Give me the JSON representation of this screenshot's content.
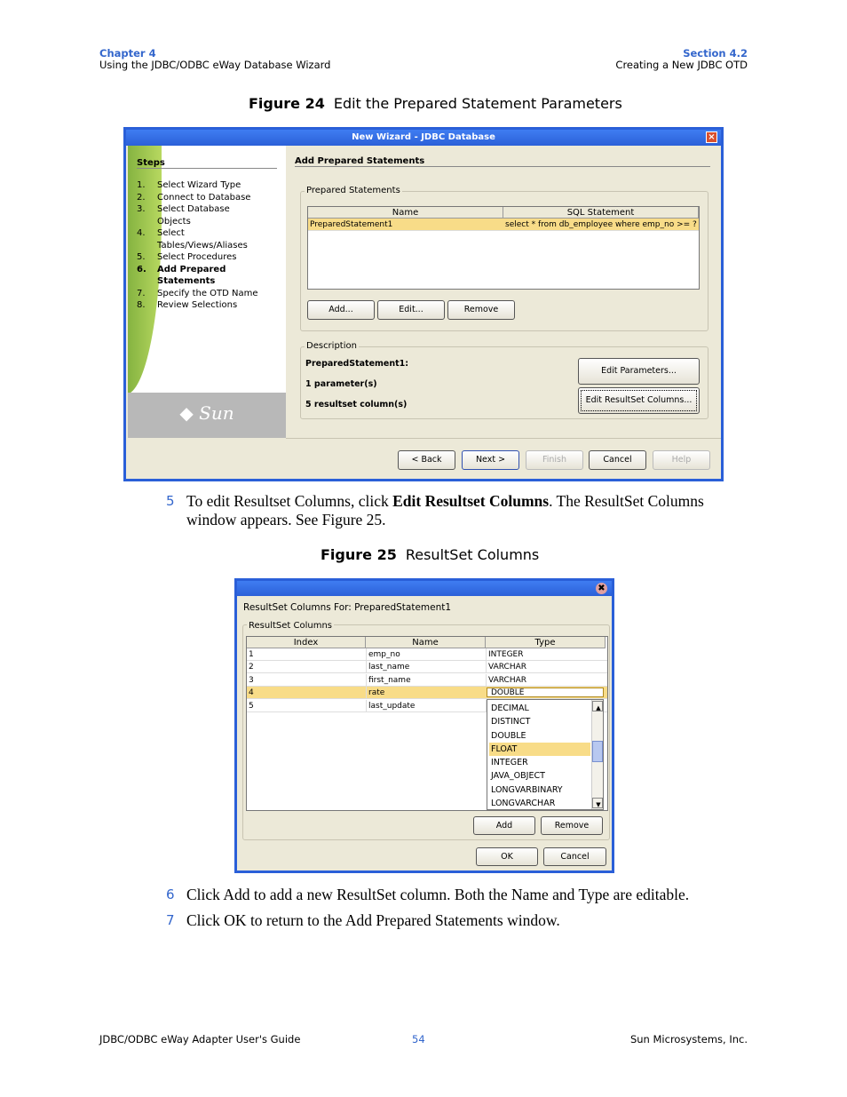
{
  "header": {
    "chapter": "Chapter 4",
    "chapter_title": "Using the JDBC/ODBC eWay Database Wizard",
    "section": "Section 4.2",
    "section_title": "Creating a New JDBC OTD"
  },
  "figure24": {
    "label": "Figure 24",
    "title": "Edit the Prepared Statement Parameters"
  },
  "wizard": {
    "title": "New Wizard - JDBC Database",
    "steps_heading": "Steps",
    "steps": [
      {
        "n": "1.",
        "label": "Select Wizard Type"
      },
      {
        "n": "2.",
        "label": "Connect to Database"
      },
      {
        "n": "3.",
        "label": "Select Database Objects"
      },
      {
        "n": "4.",
        "label": "Select Tables/Views/Aliases"
      },
      {
        "n": "5.",
        "label": "Select Procedures"
      },
      {
        "n": "6.",
        "label": "Add Prepared Statements",
        "current": true
      },
      {
        "n": "7.",
        "label": "Specify the OTD Name"
      },
      {
        "n": "8.",
        "label": "Review Selections"
      }
    ],
    "logo": "Sun",
    "panel_title": "Add Prepared Statements",
    "prepared_group": "Prepared Statements",
    "columns": [
      "Name",
      "SQL Statement"
    ],
    "rows": [
      [
        "PreparedStatement1",
        "select * from db_employee where emp_no >= ?"
      ]
    ],
    "add": "Add...",
    "edit": "Edit...",
    "remove": "Remove",
    "desc_group": "Description",
    "desc_name": "PreparedStatement1:",
    "desc_params": "1 parameter(s)",
    "desc_cols": "5 resultset column(s)",
    "edit_params": "Edit Parameters...",
    "edit_resultset": "Edit ResultSet Columns...",
    "back": "< Back",
    "next": "Next >",
    "finish": "Finish",
    "cancel": "Cancel",
    "help": "Help"
  },
  "step5": {
    "n": "5",
    "pre": "To edit Resultset Columns, click ",
    "bold": "Edit Resultset Columns",
    "post": ". The ResultSet Columns window appears. See Figure 25."
  },
  "figure25": {
    "label": "Figure 25",
    "title": "ResultSet Columns"
  },
  "rs": {
    "heading": "ResultSet Columns For:  PreparedStatement1",
    "group": "ResultSet Columns",
    "columns": [
      "Index",
      "Name",
      "Type"
    ],
    "rows": [
      [
        "1",
        "emp_no",
        "INTEGER"
      ],
      [
        "2",
        "last_name",
        "VARCHAR"
      ],
      [
        "3",
        "first_name",
        "VARCHAR"
      ],
      [
        "4",
        "rate",
        "DOUBLE"
      ],
      [
        "5",
        "last_update",
        ""
      ]
    ],
    "dropdown": [
      "DECIMAL",
      "DISTINCT",
      "DOUBLE",
      "FLOAT",
      "INTEGER",
      "JAVA_OBJECT",
      "LONGVARBINARY",
      "LONGVARCHAR"
    ],
    "add": "Add",
    "remove": "Remove",
    "ok": "OK",
    "cancel": "Cancel"
  },
  "step6": {
    "n": "6",
    "text": "Click Add to add a new ResultSet column. Both the Name and Type are editable."
  },
  "step7": {
    "n": "7",
    "text": "Click OK to return to the Add Prepared Statements window."
  },
  "footer": {
    "left": "JDBC/ODBC eWay Adapter User's Guide",
    "page": "54",
    "right": "Sun Microsystems, Inc."
  }
}
